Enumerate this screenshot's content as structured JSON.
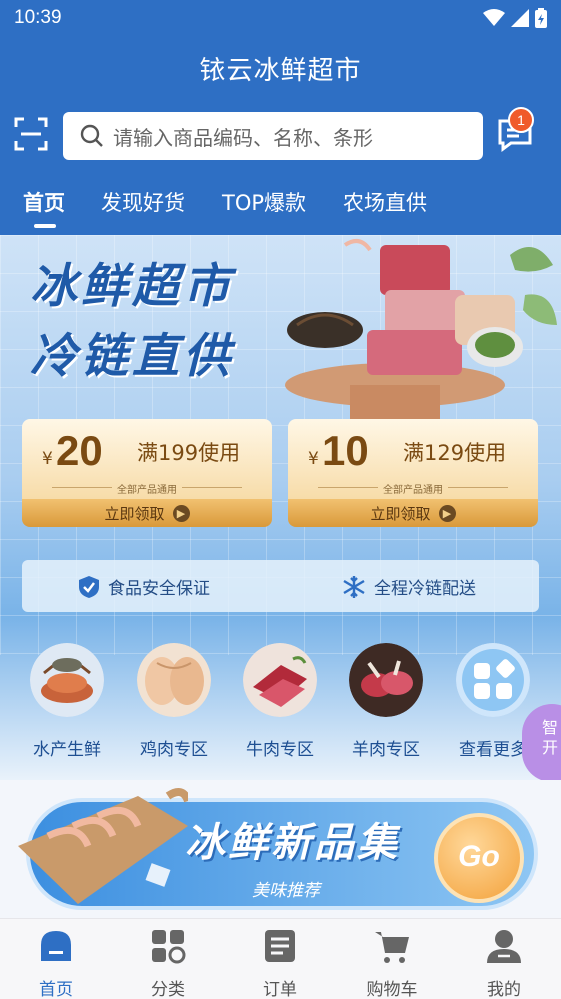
{
  "status_bar": {
    "time": "10:39",
    "icons": [
      "wifi-icon",
      "signal-icon",
      "battery-icon"
    ]
  },
  "app": {
    "title": "铱云冰鲜超市"
  },
  "search": {
    "placeholder": "请输入商品编码、名称、条形"
  },
  "messages": {
    "badge_count": "1"
  },
  "tabs": [
    {
      "label": "首页",
      "active": true
    },
    {
      "label": "发现好货",
      "active": false
    },
    {
      "label": "TOP爆款",
      "active": false
    },
    {
      "label": "农场直供",
      "active": false
    }
  ],
  "banner": {
    "headline_line1": "冰鲜超市",
    "headline_line2": "冷链直供"
  },
  "coupons": [
    {
      "currency": "¥",
      "amount": "20",
      "condition": "满199使用",
      "scope": "全部产品通用",
      "action": "立即领取"
    },
    {
      "currency": "¥",
      "amount": "10",
      "condition": "满129使用",
      "scope": "全部产品通用",
      "action": "立即领取"
    }
  ],
  "assurances": [
    {
      "label": "食品安全保证",
      "icon": "shield-check-icon"
    },
    {
      "label": "全程冷链配送",
      "icon": "snowflake-icon"
    }
  ],
  "categories": [
    {
      "label": "水产生鲜",
      "icon": "crab-icon"
    },
    {
      "label": "鸡肉专区",
      "icon": "chicken-icon"
    },
    {
      "label": "牛肉专区",
      "icon": "beef-icon"
    },
    {
      "label": "羊肉专区",
      "icon": "lamb-icon"
    },
    {
      "label": "查看更多",
      "icon": "grid-more-icon"
    }
  ],
  "float_button": {
    "text_line1": "智",
    "text_line2": "开"
  },
  "promo": {
    "title": "冰鲜新品集",
    "subtitle": "美味推荐",
    "go": "Go"
  },
  "bottom_nav": [
    {
      "label": "首页",
      "icon": "home-icon",
      "active": true
    },
    {
      "label": "分类",
      "icon": "category-icon",
      "active": false
    },
    {
      "label": "订单",
      "icon": "order-icon",
      "active": false
    },
    {
      "label": "购物车",
      "icon": "cart-icon",
      "active": false
    },
    {
      "label": "我的",
      "icon": "profile-icon",
      "active": false
    }
  ],
  "colors": {
    "primary": "#2e6fc4",
    "badge": "#f05a2a",
    "coupon_text": "#7a4a12",
    "nav_active": "#2e6fc4"
  }
}
